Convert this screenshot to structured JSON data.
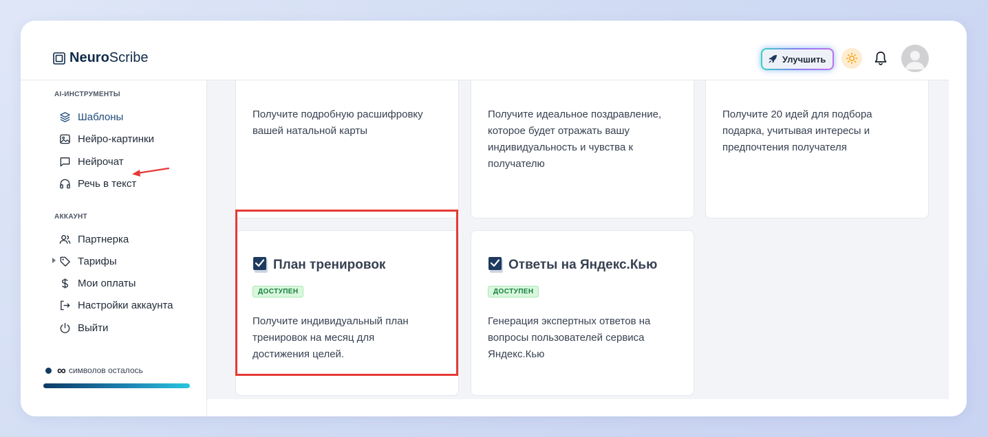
{
  "header": {
    "logo_bold": "Neuro",
    "logo_light": "Scribe",
    "upgrade_label": "Улучшить"
  },
  "sidebar": {
    "sections": [
      {
        "title": "AI-ИНСТРУМЕНТЫ",
        "items": [
          {
            "label": "Шаблоны",
            "icon": "layers-icon",
            "active": true
          },
          {
            "label": "Нейро-картинки",
            "icon": "image-icon"
          },
          {
            "label": "Нейрочат",
            "icon": "chat-icon"
          },
          {
            "label": "Речь в текст",
            "icon": "headphones-icon"
          }
        ]
      },
      {
        "title": "АККАУНТ",
        "items": [
          {
            "label": "Партнерка",
            "icon": "users-icon"
          },
          {
            "label": "Тарифы",
            "icon": "tag-icon"
          },
          {
            "label": "Мои оплаты",
            "icon": "dollar-icon"
          },
          {
            "label": "Настройки аккаунта",
            "icon": "logout-arrow-icon"
          },
          {
            "label": "Выйти",
            "icon": "power-icon"
          }
        ]
      }
    ],
    "remaining_value": "∞",
    "remaining_label": "символов осталось"
  },
  "cards_top": [
    {
      "description": [
        "Получите подробную расшифровку",
        "вашей натальной карты"
      ]
    },
    {
      "description": [
        "Получите идеальное поздравление,",
        "которое будет отражать вашу",
        "индивидуальность и чувства к",
        "получателю"
      ]
    },
    {
      "description": [
        "Получите 20 идей для подбора",
        "подарка, учитывая интересы и",
        "предпочтения получателя"
      ]
    }
  ],
  "cards_bottom": [
    {
      "title": "План тренировок",
      "badge": "ДОСТУПЕН",
      "description": [
        "Получите индивидуальный план",
        "тренировок на месяц для",
        "достижения целей."
      ]
    },
    {
      "title": "Ответы на Яндекс.Кью",
      "badge": "ДОСТУПЕН",
      "description": [
        "Генерация экспертных ответов на",
        "вопросы пользователей сервиса",
        "Яндекс.Кью"
      ]
    }
  ],
  "colors": {
    "highlight": "#e53935",
    "accent_navy": "#0f2a4a",
    "badge_green": "#15803d"
  }
}
